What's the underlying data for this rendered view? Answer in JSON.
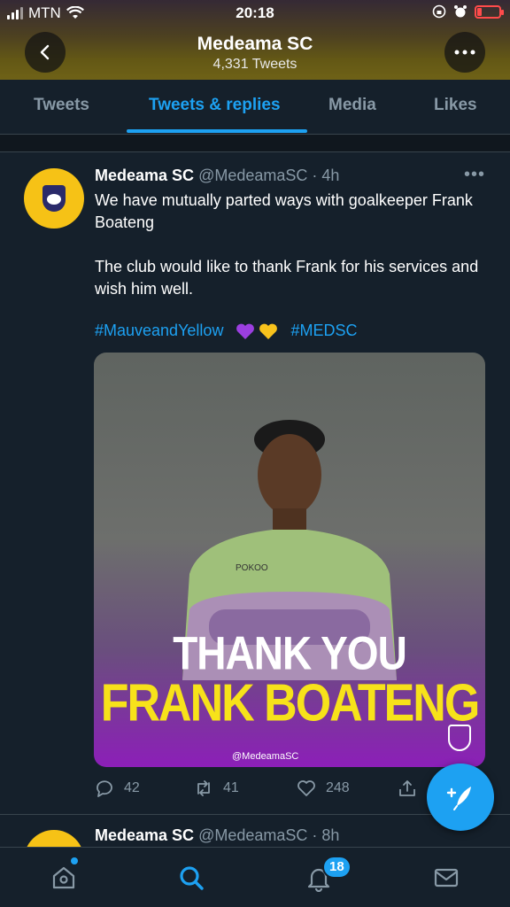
{
  "status_bar": {
    "carrier": "MTN",
    "time": "20:18"
  },
  "header": {
    "title": "Medeama SC",
    "subtitle": "4,331 Tweets",
    "back_icon": "chevron-left-icon",
    "more_icon": "more-horizontal-icon"
  },
  "tabs": [
    {
      "label": "Tweets",
      "active": false
    },
    {
      "label": "Tweets & replies",
      "active": true
    },
    {
      "label": "Media",
      "active": false
    },
    {
      "label": "Likes",
      "active": false
    }
  ],
  "tweet": {
    "name": "Medeama SC",
    "handle_time": "@MedeamaSC · 4h",
    "body": "We have mutually parted ways with goalkeeper Frank Boateng\n\nThe club would like to thank Frank for his services and wish him well.",
    "hashtag1": "#MauveandYellow",
    "hashtag2": "#MEDSC",
    "media": {
      "line1": "THANK YOU",
      "line2": "FRANK BOATENG",
      "jersey_text": "POKOO",
      "handle": "@MedeamaSC"
    },
    "replies": "42",
    "retweets": "41",
    "likes": "248"
  },
  "tweet2": {
    "name": "Medeama SC",
    "handle_time": "@MedeamaSC · 8h"
  },
  "bottom_nav": {
    "notifications_badge": "18"
  },
  "colors": {
    "accent": "#1da1f2",
    "background": "#15202b",
    "muted": "#8899a6",
    "club_yellow": "#f6c216"
  }
}
